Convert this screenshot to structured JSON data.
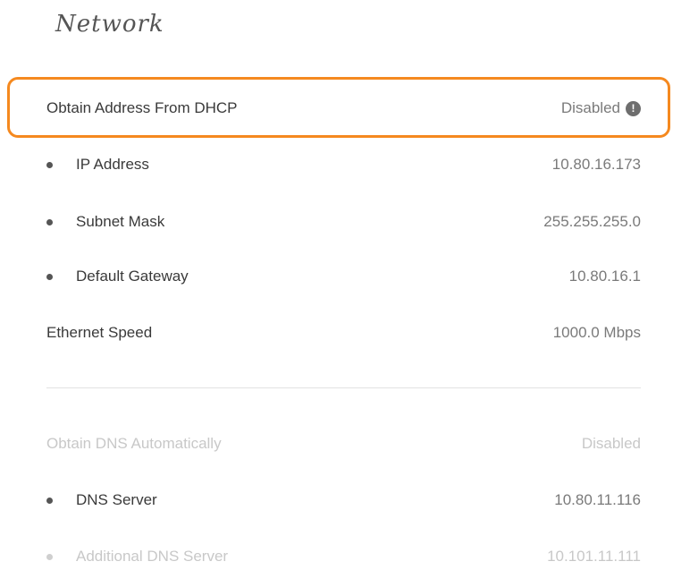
{
  "title": "Network",
  "dhcp": {
    "label": "Obtain Address From DHCP",
    "value": "Disabled",
    "icon": "info-icon"
  },
  "ip": {
    "label": "IP Address",
    "value": "10.80.16.173"
  },
  "subnet": {
    "label": "Subnet Mask",
    "value": "255.255.255.0"
  },
  "gateway": {
    "label": "Default Gateway",
    "value": "10.80.16.1"
  },
  "ethernet": {
    "label": "Ethernet Speed",
    "value": "1000.0 Mbps"
  },
  "dns_auto": {
    "label": "Obtain DNS Automatically",
    "value": "Disabled"
  },
  "dns": {
    "label": "DNS Server",
    "value": "10.80.11.116"
  },
  "dns_additional": {
    "label": "Additional DNS Server",
    "value": "10.101.11.111"
  },
  "colors": {
    "highlight": "#f5891f",
    "text": "#3a3a3a",
    "muted": "#7a7a7a",
    "disabled": "#c8c8c8"
  }
}
